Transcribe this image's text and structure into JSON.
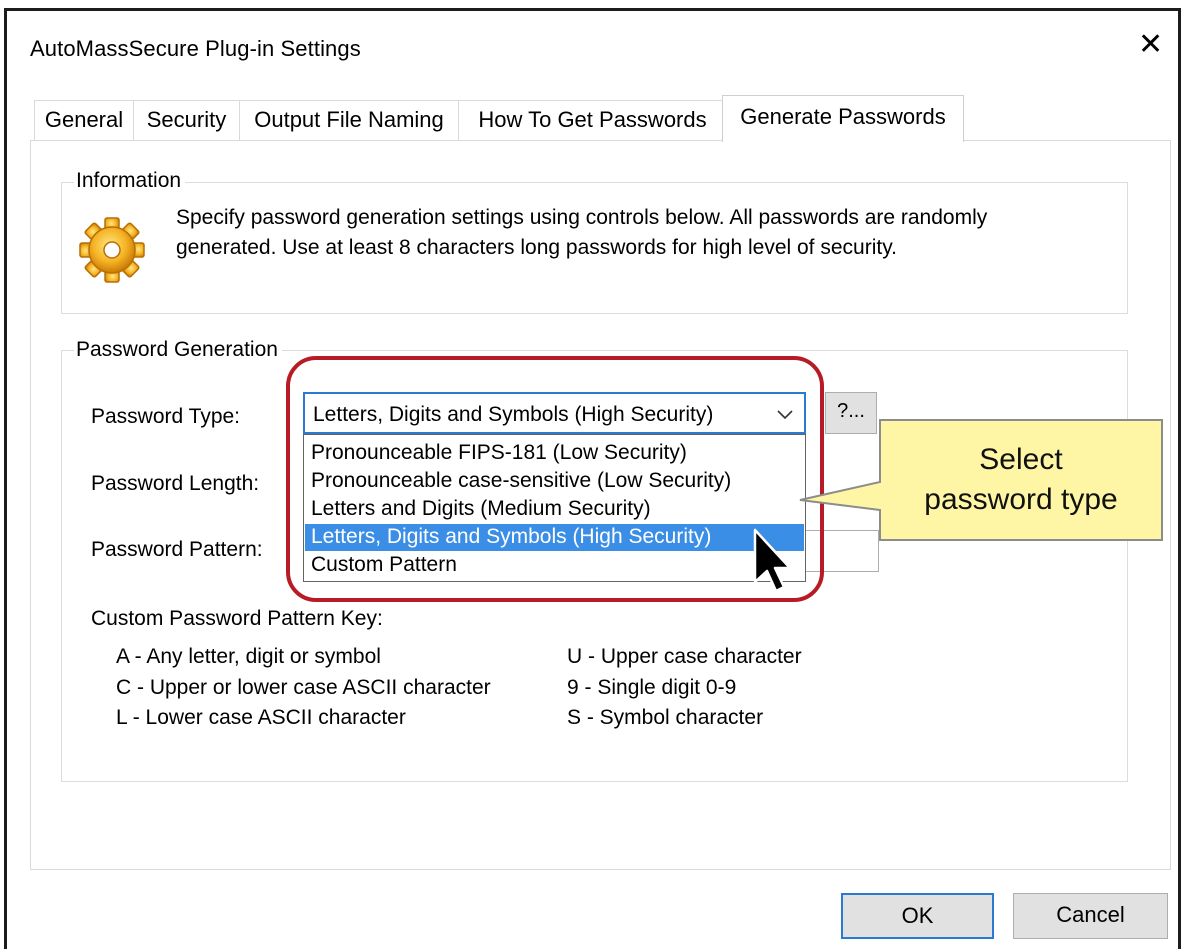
{
  "window": {
    "title": "AutoMassSecure Plug-in Settings",
    "close_glyph": "✕"
  },
  "tabs": [
    {
      "label": "General"
    },
    {
      "label": "Security"
    },
    {
      "label": "Output File Naming"
    },
    {
      "label": "How To Get Passwords"
    },
    {
      "label": "Generate Passwords",
      "active": true
    }
  ],
  "information": {
    "group_title": "Information",
    "icon": "gear-icon",
    "line1": "Specify password generation settings using controls below. All passwords are randomly",
    "line2": "generated. Use at least 8 characters long passwords for high level of security."
  },
  "password_generation": {
    "group_title": "Password Generation",
    "type_label": "Password Type:",
    "length_label": "Password Length:",
    "pattern_label": "Password Pattern:",
    "type_value": "Letters, Digits and Symbols (High Security)",
    "help_button": "?...",
    "options": [
      "Pronounceable FIPS-181 (Low Security)",
      "Pronounceable case-sensitive (Low Security)",
      "Letters and Digits (Medium Security)",
      "Letters, Digits and Symbols (High Security)",
      "Custom Pattern"
    ],
    "selected_option_index": 3,
    "key_title": "Custom Password Pattern Key:",
    "key_left": [
      "A - Any letter, digit or symbol",
      "C - Upper or lower case ASCII character",
      "L - Lower case ASCII character"
    ],
    "key_right": [
      "U - Upper case character",
      "9 - Single digit 0-9",
      "S - Symbol character"
    ]
  },
  "callout": {
    "line1": "Select",
    "line2": "password type"
  },
  "buttons": {
    "ok": "OK",
    "cancel": "Cancel"
  },
  "colors": {
    "selection": "#3b8ee5",
    "focus_border": "#2b7ad2",
    "highlight_ring": "#b71c26",
    "callout_fill": "#fff6a5"
  }
}
